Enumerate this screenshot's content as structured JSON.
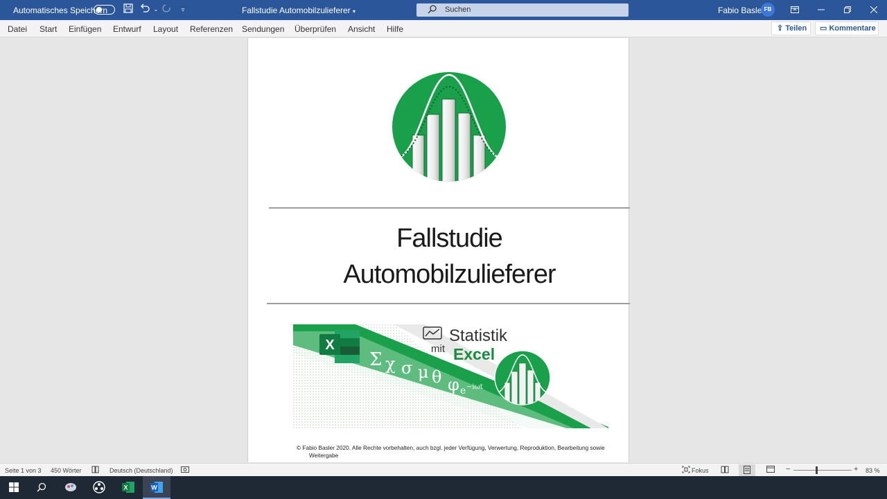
{
  "titlebar": {
    "autosave_label": "Automatisches Speichern",
    "document_title": "Fallstudie Automobilzulieferer",
    "search_placeholder": "Suchen",
    "user_name": "Fabio Basler",
    "user_initials": "FB"
  },
  "ribbon": {
    "tabs": [
      "Datei",
      "Start",
      "Einfügen",
      "Entwurf",
      "Layout",
      "Referenzen",
      "Sendungen",
      "Überprüfen",
      "Ansicht",
      "Hilfe"
    ],
    "share_label": "Teilen",
    "comments_label": "Kommentare"
  },
  "document": {
    "heading_line1": "Fallstudie",
    "heading_line2": "Automobilzulieferer",
    "banner": {
      "brand_word1": "Statistik",
      "brand_word2": "mit",
      "brand_word3": "Excel",
      "symbols": [
        "Σ",
        "χ",
        "σ",
        "μ",
        "θ",
        "φ"
      ],
      "exponent": "e",
      "exponent_sup": "−iωt"
    },
    "copyright_line1": "© Fabio Basler 2020. Alle Rechte vorbehalten, auch bzgl. jeder Verfügung, Verwertung, Reproduktion, Bearbeitung sowie",
    "copyright_line2": "Weitergabe"
  },
  "statusbar": {
    "page_info": "Seite 1 von 3",
    "word_count": "450 Wörter",
    "language": "Deutsch (Deutschland)",
    "focus_label": "Fokus",
    "zoom": "83 %"
  },
  "colors": {
    "word_blue": "#2b579a",
    "logo_green": "#1aa04a",
    "dark_green": "#0f7b3a"
  }
}
